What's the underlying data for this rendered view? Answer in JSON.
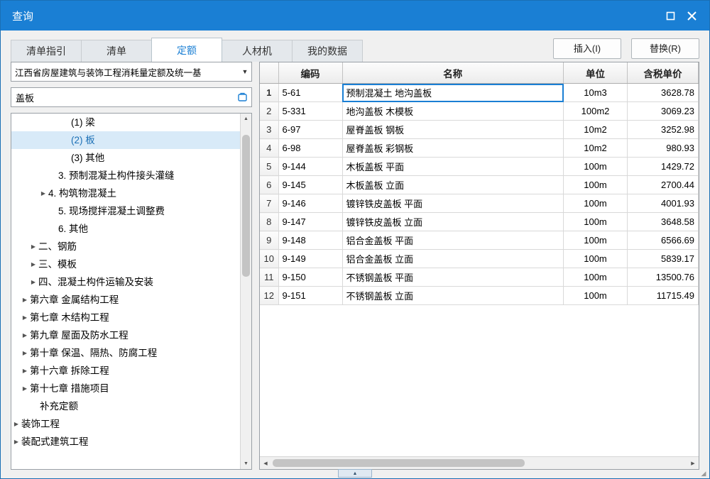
{
  "window": {
    "title": "查询",
    "controls": {
      "maximize": "maximize-icon",
      "close": "close-icon"
    }
  },
  "tabs": [
    {
      "label": "清单指引",
      "active": false
    },
    {
      "label": "清单",
      "active": false
    },
    {
      "label": "定额",
      "active": true
    },
    {
      "label": "人材机",
      "active": false
    },
    {
      "label": "我的数据",
      "active": false
    }
  ],
  "toolbar": {
    "insert_label": "插入(I)",
    "replace_label": "替换(R)"
  },
  "left": {
    "combo_value": "江西省房屋建筑与装饰工程消耗量定额及统一基",
    "combo_arrow": "chevron-down-icon",
    "search_value": "盖板",
    "search_icon": "clear-search-icon",
    "tree": [
      {
        "label": "(1) 梁",
        "indent": 5,
        "arrow": "",
        "selected": false
      },
      {
        "label": "(2) 板",
        "indent": 5,
        "arrow": "",
        "selected": true
      },
      {
        "label": "(3) 其他",
        "indent": 5,
        "arrow": "",
        "selected": false
      },
      {
        "label": "3. 预制混凝土构件接头灌缝",
        "indent": 4,
        "arrow": "",
        "selected": false
      },
      {
        "label": "4. 构筑物混凝土",
        "indent": 4,
        "arrow": "▶",
        "selected": false
      },
      {
        "label": "5. 现场搅拌混凝土调整费",
        "indent": 4,
        "arrow": "",
        "selected": false
      },
      {
        "label": "6. 其他",
        "indent": 4,
        "arrow": "",
        "selected": false
      },
      {
        "label": "二、钢筋",
        "indent": 3,
        "arrow": "▶",
        "selected": false
      },
      {
        "label": "三、模板",
        "indent": 3,
        "arrow": "▶",
        "selected": false
      },
      {
        "label": "四、混凝土构件运输及安装",
        "indent": 3,
        "arrow": "▶",
        "selected": false
      },
      {
        "label": "第六章 金属结构工程",
        "indent": 2,
        "arrow": "▶",
        "selected": false
      },
      {
        "label": "第七章 木结构工程",
        "indent": 2,
        "arrow": "▶",
        "selected": false
      },
      {
        "label": "第九章 屋面及防水工程",
        "indent": 2,
        "arrow": "▶",
        "selected": false
      },
      {
        "label": "第十章 保温、隔热、防腐工程",
        "indent": 2,
        "arrow": "▶",
        "selected": false
      },
      {
        "label": "第十六章 拆除工程",
        "indent": 2,
        "arrow": "▶",
        "selected": false
      },
      {
        "label": "第十七章 措施项目",
        "indent": 2,
        "arrow": "▶",
        "selected": false
      },
      {
        "label": "补充定额",
        "indent": 2,
        "arrow": "",
        "selected": false
      },
      {
        "label": "装饰工程",
        "indent": 1,
        "arrow": "▶",
        "selected": false
      },
      {
        "label": "装配式建筑工程",
        "indent": 1,
        "arrow": "▶",
        "selected": false
      }
    ]
  },
  "grid": {
    "columns": [
      "",
      "编码",
      "名称",
      "单位",
      "含税单价"
    ],
    "rows": [
      {
        "idx": "1",
        "code": "5-61",
        "name": "预制混凝土 地沟盖板",
        "unit": "10m3",
        "price": "3628.78",
        "selected": true
      },
      {
        "idx": "2",
        "code": "5-331",
        "name": "地沟盖板 木模板",
        "unit": "100m2",
        "price": "3069.23",
        "selected": false
      },
      {
        "idx": "3",
        "code": "6-97",
        "name": "屋脊盖板 钢板",
        "unit": "10m2",
        "price": "3252.98",
        "selected": false
      },
      {
        "idx": "4",
        "code": "6-98",
        "name": "屋脊盖板 彩钢板",
        "unit": "10m2",
        "price": "980.93",
        "selected": false
      },
      {
        "idx": "5",
        "code": "9-144",
        "name": "木板盖板 平面",
        "unit": "100m",
        "price": "1429.72",
        "selected": false
      },
      {
        "idx": "6",
        "code": "9-145",
        "name": "木板盖板 立面",
        "unit": "100m",
        "price": "2700.44",
        "selected": false
      },
      {
        "idx": "7",
        "code": "9-146",
        "name": "镀锌铁皮盖板 平面",
        "unit": "100m",
        "price": "4001.93",
        "selected": false
      },
      {
        "idx": "8",
        "code": "9-147",
        "name": "镀锌铁皮盖板 立面",
        "unit": "100m",
        "price": "3648.58",
        "selected": false
      },
      {
        "idx": "9",
        "code": "9-148",
        "name": "铝合金盖板 平面",
        "unit": "100m",
        "price": "6566.69",
        "selected": false
      },
      {
        "idx": "10",
        "code": "9-149",
        "name": "铝合金盖板 立面",
        "unit": "100m",
        "price": "5839.17",
        "selected": false
      },
      {
        "idx": "11",
        "code": "9-150",
        "name": "不锈钢盖板 平面",
        "unit": "100m",
        "price": "13500.76",
        "selected": false
      },
      {
        "idx": "12",
        "code": "9-151",
        "name": "不锈钢盖板 立面",
        "unit": "100m",
        "price": "11715.49",
        "selected": false
      }
    ]
  },
  "colors": {
    "titlebar": "#1a7fd4",
    "accent": "#1a7fd4",
    "selection": "#d8eaf8"
  }
}
